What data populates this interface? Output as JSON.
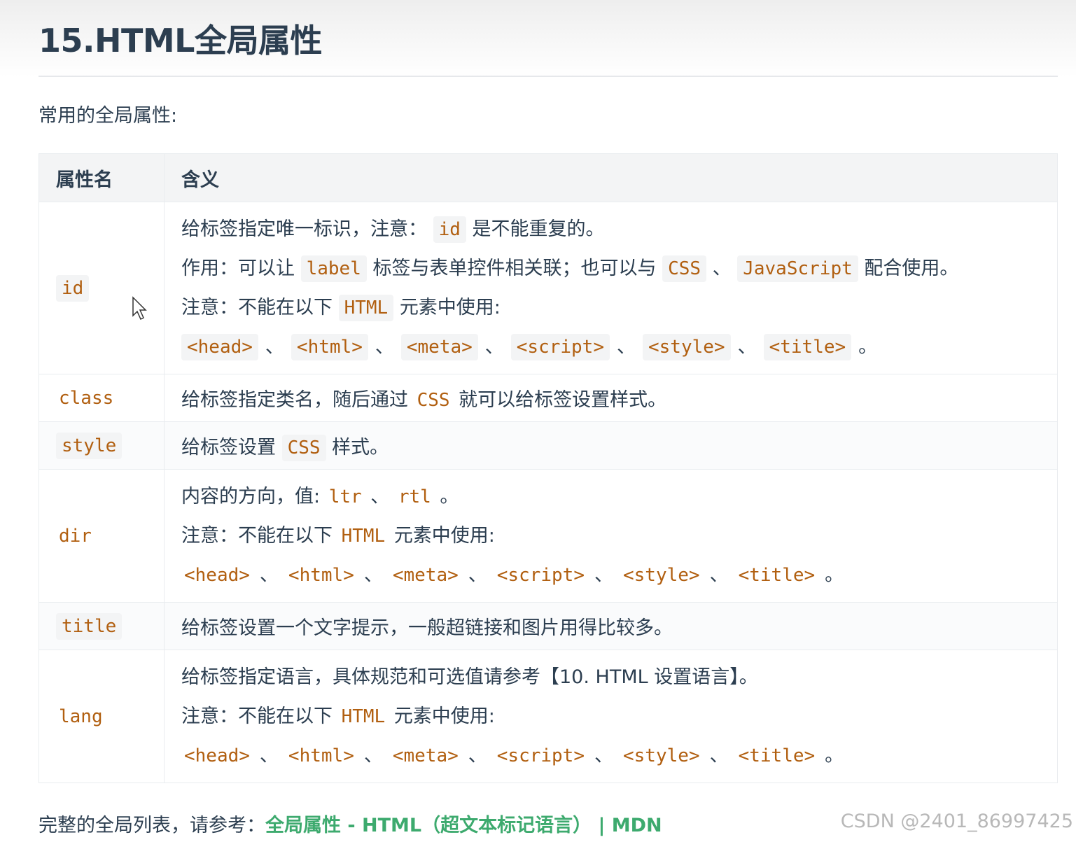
{
  "title": "15.HTML全局属性",
  "intro": "常用的全局属性:",
  "table": {
    "headers": [
      "属性名",
      "含义"
    ],
    "tags": [
      "<head>",
      "<html>",
      "<meta>",
      "<script>",
      "<style>",
      "<title>"
    ],
    "rows": {
      "id": {
        "name": "id",
        "l1a": "给标签指定唯一标识，注意：",
        "l1code": "id",
        "l1b": "是不能重复的。",
        "l2a": "作用：可以让",
        "l2code1": "label",
        "l2b": "标签与表单控件相关联；也可以与",
        "l2code2": "CSS",
        "l2c": "、",
        "l2code3": "JavaScript",
        "l2d": "配合使用。",
        "l3a": "注意：不能在以下",
        "l3code": "HTML",
        "l3b": "元素中使用:"
      },
      "class": {
        "name": "class",
        "a": "给标签指定类名，随后通过",
        "code": "CSS",
        "b": "就可以给标签设置样式。"
      },
      "style": {
        "name": "style",
        "a": "给标签设置",
        "code": "CSS",
        "b": "样式。"
      },
      "dir": {
        "name": "dir",
        "l1a": "内容的方向，值:",
        "code1": "ltr",
        "sep": "、",
        "code2": "rtl",
        "end": "。",
        "l2a": "注意：不能在以下",
        "l2code": "HTML",
        "l2b": "元素中使用:"
      },
      "title": {
        "name": "title",
        "text": "给标签设置一个文字提示，一般超链接和图片用得比较多。"
      },
      "lang": {
        "name": "lang",
        "l1": "给标签指定语言，具体规范和可选值请参考【10. HTML 设置语言】。",
        "l2a": "注意：不能在以下",
        "l2code": "HTML",
        "l2b": "元素中使用:"
      }
    }
  },
  "footer": {
    "prefix": "完整的全局列表，请参考：",
    "link": "全局属性 - HTML（超文本标记语言） | MDN"
  },
  "watermark": "CSDN @2401_86997425"
}
